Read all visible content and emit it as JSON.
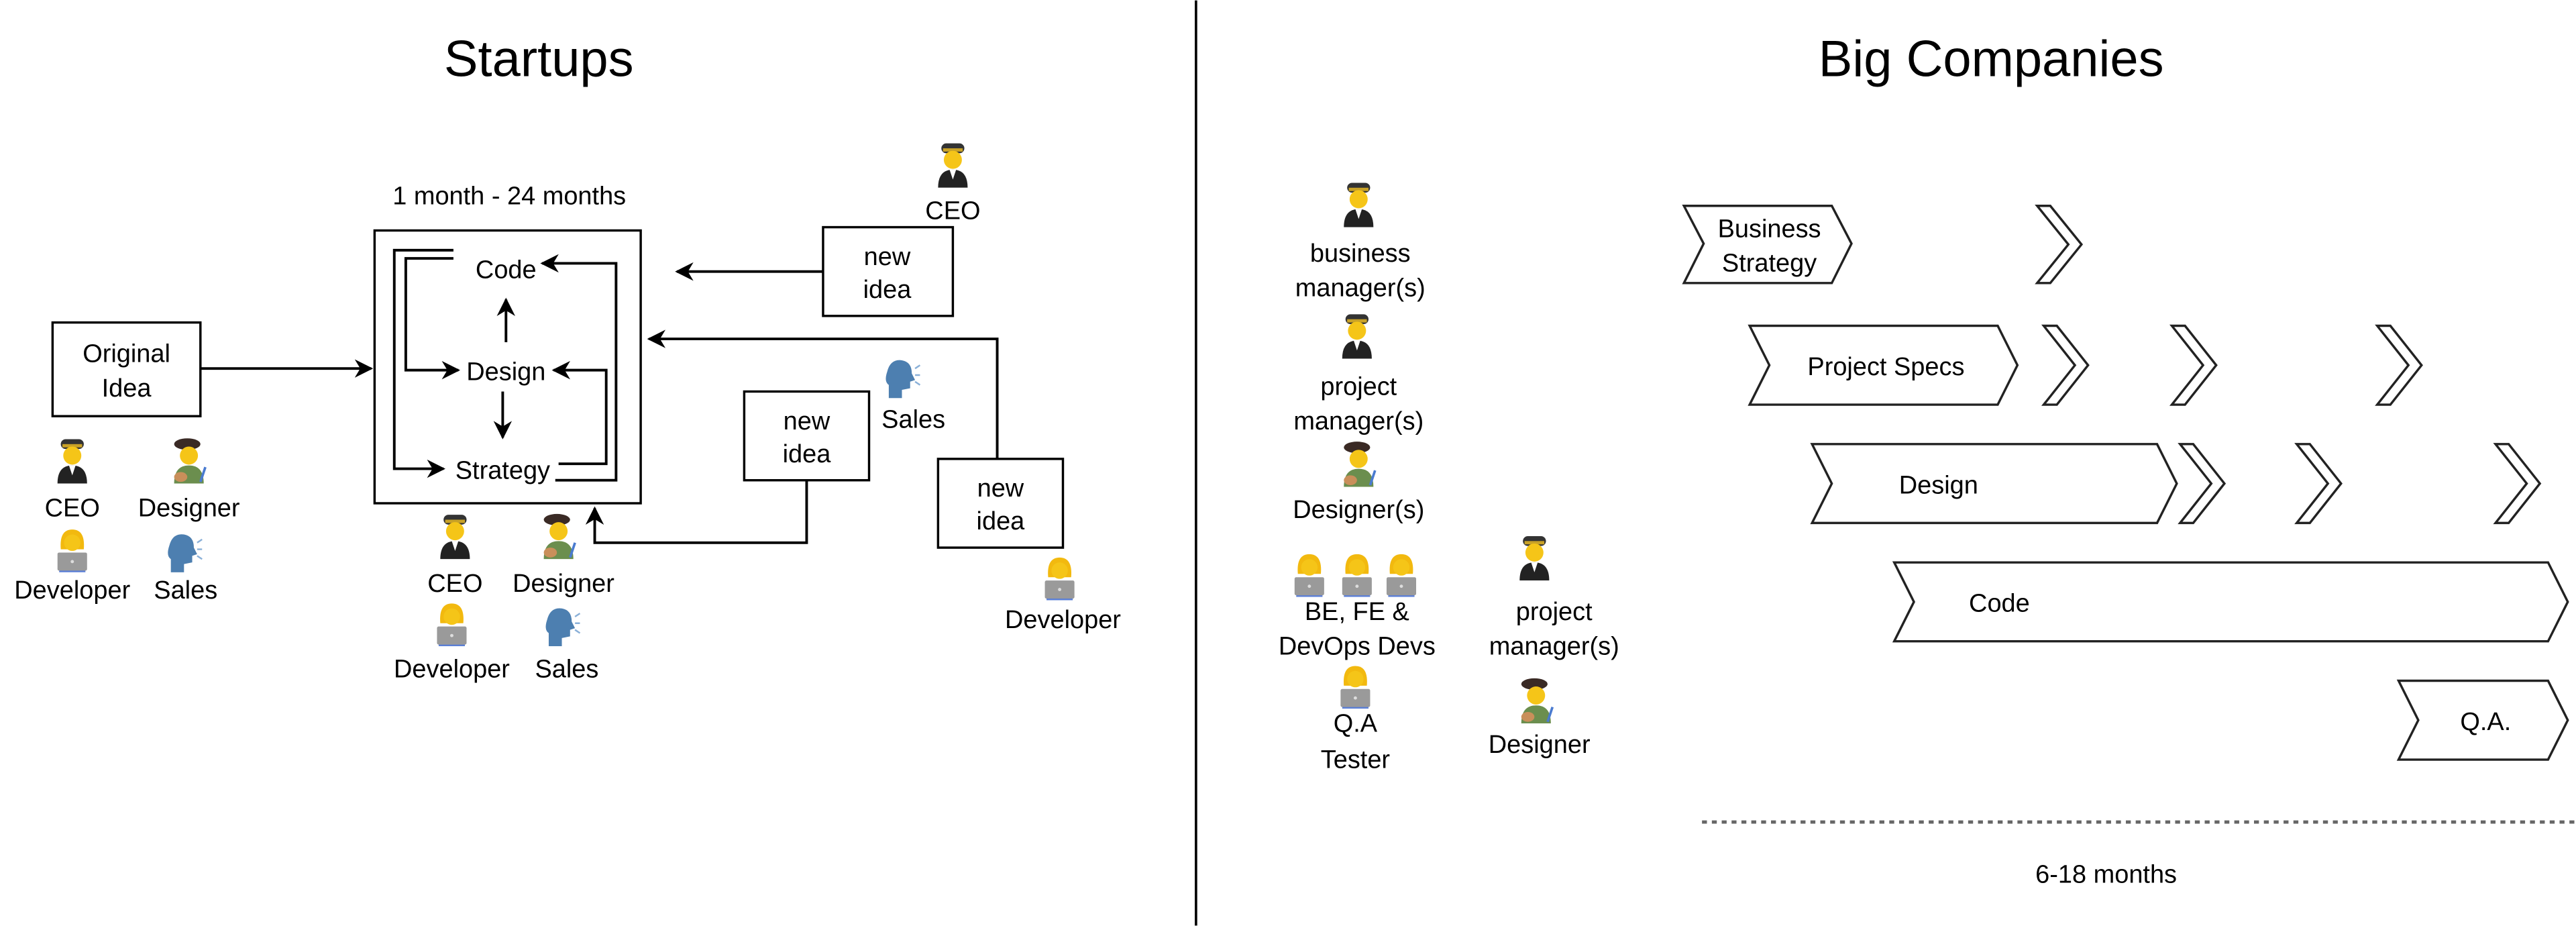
{
  "startups": {
    "title": "Startups",
    "duration": "1 month - 24 months",
    "original_idea": [
      "Original",
      "Idea"
    ],
    "loop": {
      "code": "Code",
      "design": "Design",
      "strategy": "Strategy"
    },
    "team_left": [
      {
        "label": "CEO",
        "icon": "pilot-icon"
      },
      {
        "label": "Designer",
        "icon": "artist-icon"
      },
      {
        "label": "Developer",
        "icon": "technologist-icon"
      },
      {
        "label": "Sales",
        "icon": "speaking-head-icon"
      }
    ],
    "team_bottom": [
      {
        "label": "CEO",
        "icon": "pilot-icon"
      },
      {
        "label": "Designer",
        "icon": "artist-icon"
      },
      {
        "label": "Developer",
        "icon": "technologist-icon"
      },
      {
        "label": "Sales",
        "icon": "speaking-head-icon"
      }
    ],
    "new_ideas": [
      {
        "lines": [
          "new",
          "idea"
        ],
        "source": "CEO",
        "icon": "pilot-icon"
      },
      {
        "lines": [
          "new",
          "idea"
        ],
        "source": "Sales",
        "icon": "speaking-head-icon"
      },
      {
        "lines": [
          "new",
          "idea"
        ],
        "source": "Developer",
        "icon": "technologist-icon"
      }
    ]
  },
  "big_companies": {
    "title": "Big Companies",
    "roles": [
      {
        "lines": [
          "business",
          "manager(s)"
        ],
        "icon": "pilot-icon"
      },
      {
        "lines": [
          "project",
          "manager(s)"
        ],
        "icon": "pilot-icon"
      },
      {
        "lines": [
          "Designer(s)"
        ],
        "icon": "artist-icon"
      },
      {
        "lines": [
          "BE, FE &",
          "DevOps Devs"
        ],
        "icon": "technologist-icon"
      },
      {
        "lines": [
          "Q.A",
          "Tester"
        ],
        "icon": "technologist-icon"
      },
      {
        "lines": [
          "project",
          "manager(s)"
        ],
        "icon": "pilot-icon"
      },
      {
        "lines": [
          "Designer"
        ],
        "icon": "artist-icon"
      }
    ],
    "phases": [
      {
        "lines": [
          "Business",
          "Strategy"
        ]
      },
      {
        "lines": [
          "Project Specs"
        ]
      },
      {
        "lines": [
          "Design"
        ]
      },
      {
        "lines": [
          "Code"
        ]
      },
      {
        "lines": [
          "Q.A."
        ]
      }
    ],
    "duration": "6-18 months"
  }
}
